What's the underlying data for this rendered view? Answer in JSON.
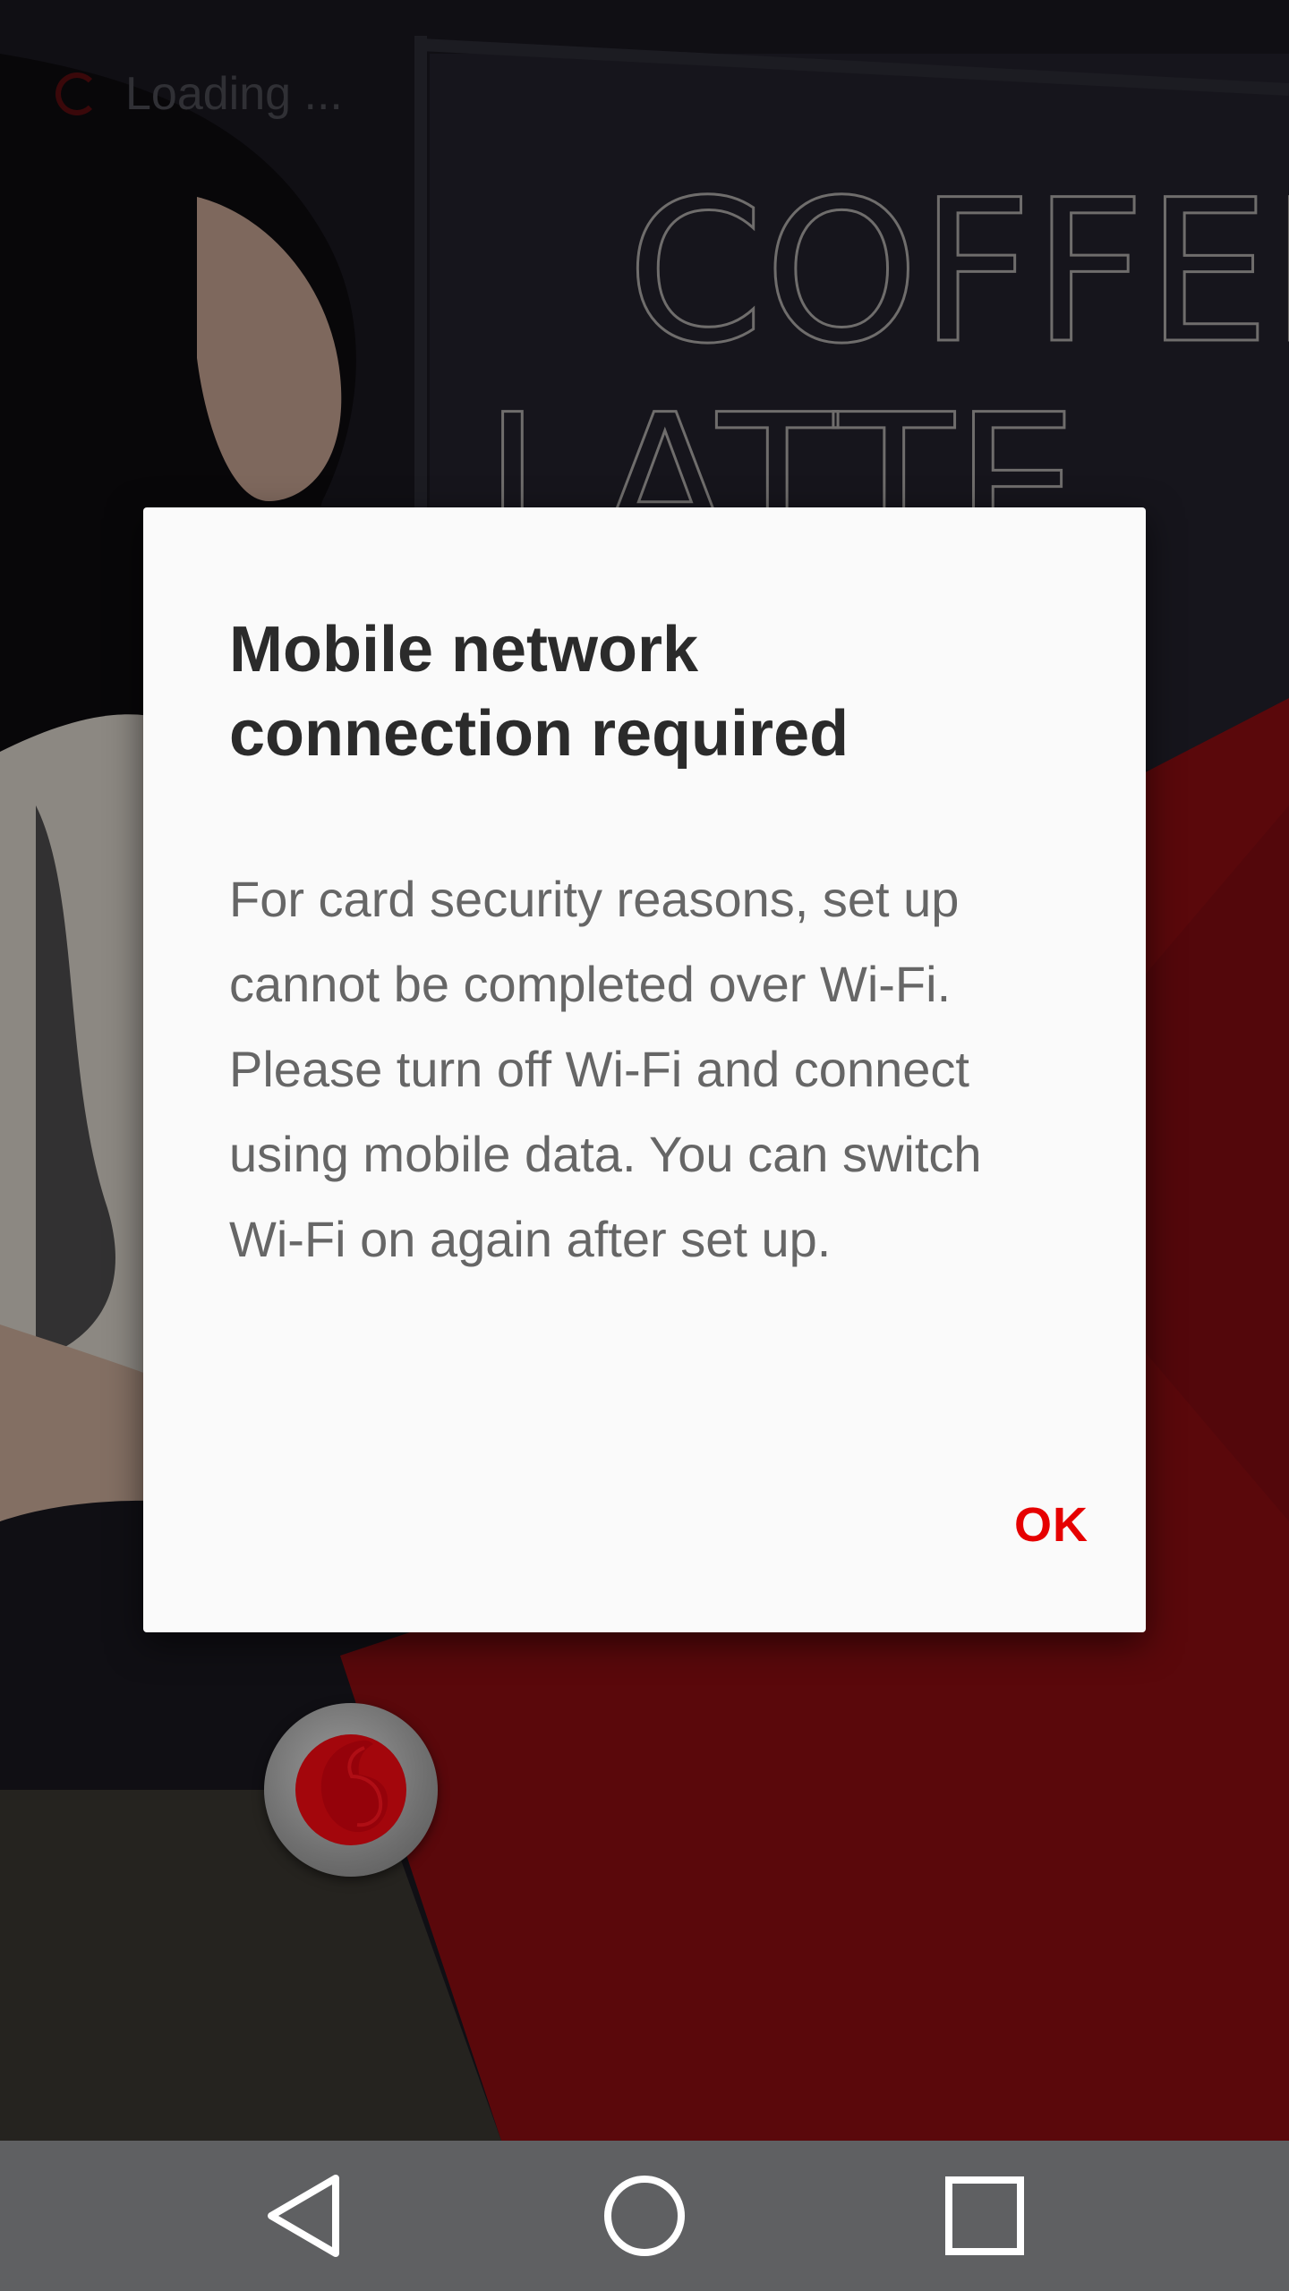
{
  "status": {
    "loading_text": "Loading ..."
  },
  "dialog": {
    "title": "Mobile network connection required",
    "message": "For card security reasons, set up cannot be completed over Wi-Fi. Please turn off Wi-Fi and connect using mobile data. You can switch Wi-Fi on again after set up.",
    "ok_label": "OK"
  },
  "background": {
    "chalkboard_text_line1": "COFFEE",
    "chalkboard_text_line2": "LATTE"
  },
  "navigation": {
    "back_icon": "back-triangle-icon",
    "home_icon": "home-circle-icon",
    "recents_icon": "recents-square-icon"
  },
  "colors": {
    "accent": "#e60000",
    "dialog_bg": "#fafafa",
    "title_text": "#2b2b2b",
    "body_text": "#666666",
    "nav_bar": "#5f6062",
    "brand_red_dark": "#6b0a0c"
  }
}
